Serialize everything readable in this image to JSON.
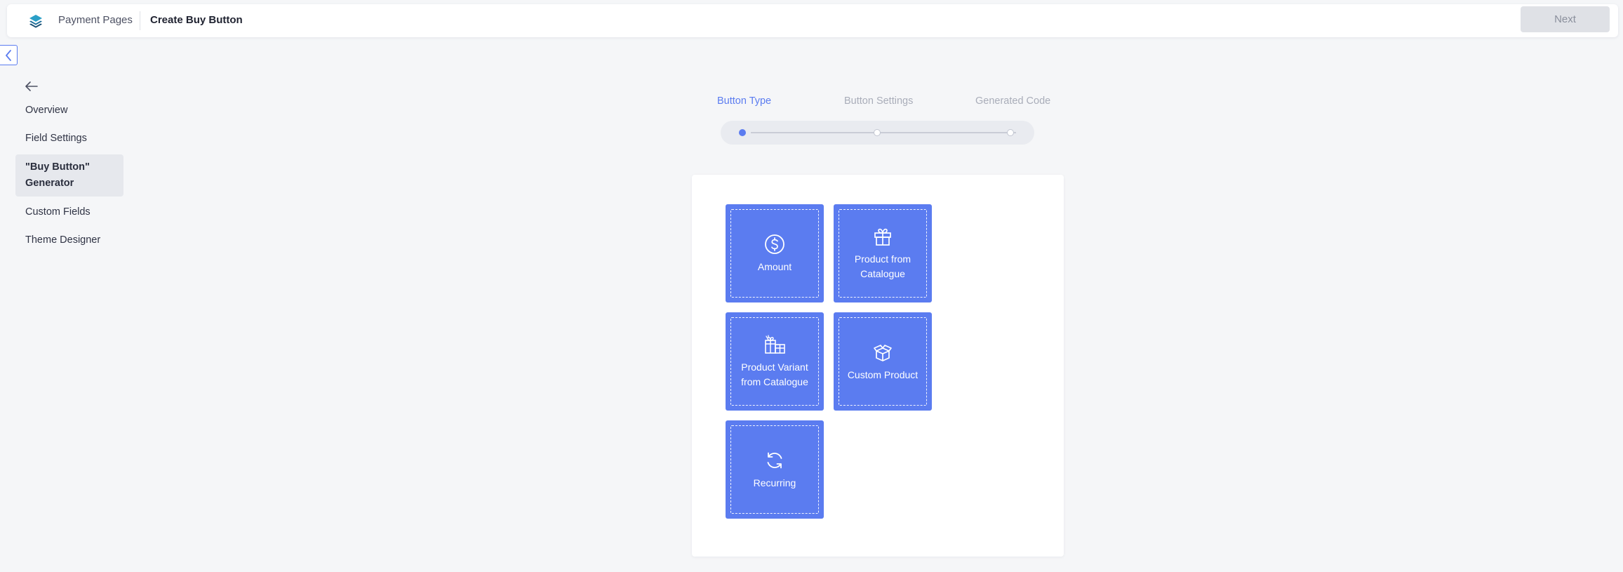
{
  "header": {
    "breadcrumb_parent": "Payment Pages",
    "breadcrumb_current": "Create Buy Button",
    "next_label": "Next"
  },
  "sidebar": {
    "items": [
      {
        "label": "Overview"
      },
      {
        "label": "Field Settings"
      },
      {
        "label": "\"Buy Button\" Generator"
      },
      {
        "label": "Custom Fields"
      },
      {
        "label": "Theme Designer"
      }
    ],
    "active_index": 2
  },
  "stepper": {
    "steps": [
      {
        "label": "Button Type",
        "state": "active"
      },
      {
        "label": "Button Settings",
        "state": "upcoming"
      },
      {
        "label": "Generated Code",
        "state": "upcoming"
      }
    ]
  },
  "button_types": [
    {
      "label": "Amount",
      "icon": "dollar-circle-icon"
    },
    {
      "label": "Product from Catalogue",
      "icon": "gift-icon"
    },
    {
      "label": "Product Variant from Catalogue",
      "icon": "gift-variants-icon"
    },
    {
      "label": "Custom Product",
      "icon": "open-box-icon"
    },
    {
      "label": "Recurring",
      "icon": "refresh-icon"
    }
  ],
  "colors": {
    "accent": "#5b7cf0",
    "background": "#f5f6f8",
    "disabled_button": "#dfe1e6"
  }
}
